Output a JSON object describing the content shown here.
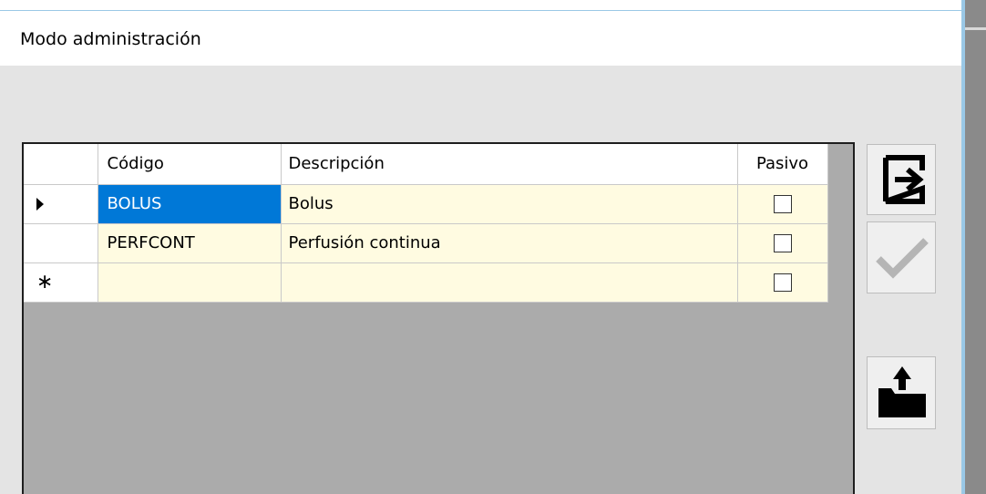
{
  "window": {
    "title": "Modo administración"
  },
  "grid": {
    "columns": [
      "Código",
      "Descripción",
      "Pasivo"
    ],
    "rows": [
      {
        "indicator": "current-row-arrow",
        "codigo": "BOLUS",
        "descripcion": "Bolus",
        "pasivo": false
      },
      {
        "indicator": "",
        "codigo": "PERFCONT",
        "descripcion": "Perfusión continua",
        "pasivo": false
      },
      {
        "indicator": "new-row-star",
        "codigo": "",
        "descripcion": "",
        "pasivo": false
      }
    ],
    "new_row_glyph": "∗"
  },
  "buttons": [
    {
      "icon": "exit-icon",
      "enabled": true
    },
    {
      "icon": "checkmark-icon",
      "enabled": false
    },
    {
      "icon": "export-folder-icon",
      "enabled": true
    }
  ],
  "colors": {
    "selection": "#0078d7",
    "row_bg": "#fffbe1",
    "grid_bg": "#ababab"
  }
}
